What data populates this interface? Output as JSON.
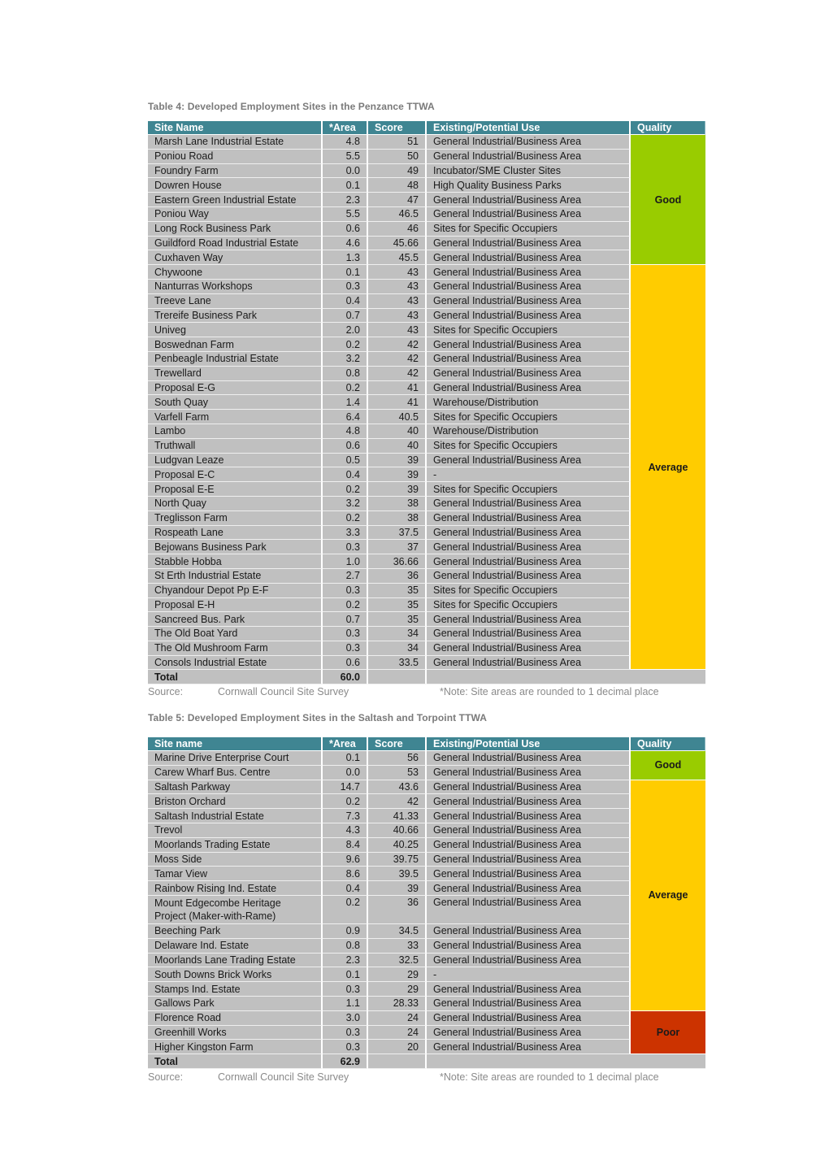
{
  "colors": {
    "header": "#3f8592",
    "row": "#c0c0c0",
    "good": "#99cc00",
    "average": "#ffcc00",
    "poor": "#cc3300"
  },
  "table4": {
    "caption": "Table 4:  Developed Employment Sites in the Penzance TTWA",
    "headers": [
      "Site Name",
      "*Area",
      "Score",
      "Existing/Potential Use",
      "Quality"
    ],
    "rows": [
      [
        "Marsh Lane Industrial Estate",
        "4.8",
        "51",
        "General Industrial/Business Area"
      ],
      [
        "Poniou Road",
        "5.5",
        "50",
        "General Industrial/Business Area"
      ],
      [
        "Foundry Farm",
        "0.0",
        "49",
        "Incubator/SME Cluster Sites"
      ],
      [
        "Dowren House",
        "0.1",
        "48",
        "High Quality Business Parks"
      ],
      [
        "Eastern Green Industrial Estate",
        "2.3",
        "47",
        "General Industrial/Business Area"
      ],
      [
        "Poniou Way",
        "5.5",
        "46.5",
        "General Industrial/Business Area"
      ],
      [
        "Long Rock Business Park",
        "0.6",
        "46",
        "Sites for Specific Occupiers"
      ],
      [
        "Guildford Road Industrial Estate",
        "4.6",
        "45.66",
        "General Industrial/Business Area"
      ],
      [
        "Cuxhaven Way",
        "1.3",
        "45.5",
        "General Industrial/Business Area"
      ],
      [
        "Chywoone",
        "0.1",
        "43",
        "General Industrial/Business Area"
      ],
      [
        "Nanturras Workshops",
        "0.3",
        "43",
        "General Industrial/Business Area"
      ],
      [
        "Treeve Lane",
        "0.4",
        "43",
        "General Industrial/Business Area"
      ],
      [
        "Trereife Business Park",
        "0.7",
        "43",
        "General Industrial/Business Area"
      ],
      [
        "Univeg",
        "2.0",
        "43",
        "Sites for Specific Occupiers"
      ],
      [
        "Boswednan Farm",
        "0.2",
        "42",
        "General Industrial/Business Area"
      ],
      [
        "Penbeagle Industrial Estate",
        "3.2",
        "42",
        "General Industrial/Business Area"
      ],
      [
        "Trewellard",
        "0.8",
        "42",
        "General Industrial/Business Area"
      ],
      [
        "Proposal E-G",
        "0.2",
        "41",
        "General Industrial/Business Area"
      ],
      [
        "South Quay",
        "1.4",
        "41",
        "Warehouse/Distribution"
      ],
      [
        "Varfell Farm",
        "6.4",
        "40.5",
        "Sites for Specific Occupiers"
      ],
      [
        "Lambo",
        "4.8",
        "40",
        "Warehouse/Distribution"
      ],
      [
        "Truthwall",
        "0.6",
        "40",
        "Sites for Specific Occupiers"
      ],
      [
        "Ludgvan Leaze",
        "0.5",
        "39",
        "General Industrial/Business Area"
      ],
      [
        "Proposal E-C",
        "0.4",
        "39",
        "-"
      ],
      [
        "Proposal E-E",
        "0.2",
        "39",
        "Sites for Specific Occupiers"
      ],
      [
        "North Quay",
        "3.2",
        "38",
        "General Industrial/Business Area"
      ],
      [
        "Treglisson Farm",
        "0.2",
        "38",
        "General Industrial/Business Area"
      ],
      [
        "Rospeath Lane",
        "3.3",
        "37.5",
        "General Industrial/Business Area"
      ],
      [
        "Bejowans Business Park",
        "0.3",
        "37",
        "General Industrial/Business Area"
      ],
      [
        "Stabble Hobba",
        "1.0",
        "36.66",
        "General Industrial/Business Area"
      ],
      [
        "St Erth Industrial Estate",
        "2.7",
        "36",
        "General Industrial/Business Area"
      ],
      [
        "Chyandour Depot Pp E-F",
        "0.3",
        "35",
        "Sites for Specific Occupiers"
      ],
      [
        "Proposal E-H",
        "0.2",
        "35",
        "Sites for Specific Occupiers"
      ],
      [
        "Sancreed Bus. Park",
        "0.7",
        "35",
        "General Industrial/Business Area"
      ],
      [
        "The Old Boat Yard",
        "0.3",
        "34",
        "General Industrial/Business Area"
      ],
      [
        "The Old Mushroom Farm",
        "0.3",
        "34",
        "General Industrial/Business Area"
      ],
      [
        "Consols Industrial Estate",
        "0.6",
        "33.5",
        "General Industrial/Business Area"
      ]
    ],
    "quality_groups": [
      {
        "label": "Good",
        "rows": 9,
        "class": "good"
      },
      {
        "label": "Average",
        "rows": 28,
        "class": "avg"
      }
    ],
    "total_label": "Total",
    "total_area": "60.0",
    "source_label": "Source:",
    "source_value": "Cornwall Council Site Survey",
    "note": "*Note: Site areas are rounded to 1 decimal place"
  },
  "table5": {
    "caption": "Table 5:  Developed Employment Sites in the Saltash and Torpoint TTWA",
    "headers": [
      "Site name",
      "*Area",
      "Score",
      "Existing/Potential Use",
      "Quality"
    ],
    "rows": [
      [
        "Marine Drive Enterprise Court",
        "0.1",
        "56",
        "General Industrial/Business Area"
      ],
      [
        "Carew Wharf Bus. Centre",
        "0.0",
        "53",
        "General Industrial/Business Area"
      ],
      [
        "Saltash Parkway",
        "14.7",
        "43.6",
        "General Industrial/Business Area"
      ],
      [
        "Briston Orchard",
        "0.2",
        "42",
        "General Industrial/Business Area"
      ],
      [
        "Saltash Industrial Estate",
        "7.3",
        "41.33",
        "General Industrial/Business Area"
      ],
      [
        "Trevol",
        "4.3",
        "40.66",
        "General Industrial/Business Area"
      ],
      [
        "Moorlands Trading Estate",
        "8.4",
        "40.25",
        "General Industrial/Business Area"
      ],
      [
        "Moss Side",
        "9.6",
        "39.75",
        "General Industrial/Business Area"
      ],
      [
        "Tamar View",
        "8.6",
        "39.5",
        "General Industrial/Business Area"
      ],
      [
        "Rainbow Rising Ind. Estate",
        "0.4",
        "39",
        "General Industrial/Business Area"
      ],
      [
        "Mount Edgecombe Heritage Project (Maker-with-Rame)",
        "0.2",
        "36",
        "General Industrial/Business Area"
      ],
      [
        "Beeching Park",
        "0.9",
        "34.5",
        "General Industrial/Business Area"
      ],
      [
        "Delaware Ind. Estate",
        "0.8",
        "33",
        "General Industrial/Business Area"
      ],
      [
        "Moorlands Lane Trading Estate",
        "2.3",
        "32.5",
        "General Industrial/Business Area"
      ],
      [
        "South Downs Brick Works",
        "0.1",
        "29",
        "-"
      ],
      [
        "Stamps Ind. Estate",
        "0.3",
        "29",
        "General Industrial/Business Area"
      ],
      [
        "Gallows Park",
        "1.1",
        "28.33",
        "General Industrial/Business Area"
      ],
      [
        "Florence Road",
        "3.0",
        "24",
        "General Industrial/Business Area"
      ],
      [
        "Greenhill Works",
        "0.3",
        "24",
        "General Industrial/Business Area"
      ],
      [
        "Higher Kingston Farm",
        "0.3",
        "20",
        "General Industrial/Business Area"
      ]
    ],
    "quality_groups": [
      {
        "label": "Good",
        "rows": 2,
        "class": "good"
      },
      {
        "label": "Average",
        "rows": 15,
        "class": "avg"
      },
      {
        "label": "Poor",
        "rows": 3,
        "class": "poor"
      }
    ],
    "total_label": "Total",
    "total_area": "62.9",
    "source_label": "Source:",
    "source_value": "Cornwall Council Site Survey",
    "note": "*Note: Site areas are rounded to 1 decimal place"
  }
}
